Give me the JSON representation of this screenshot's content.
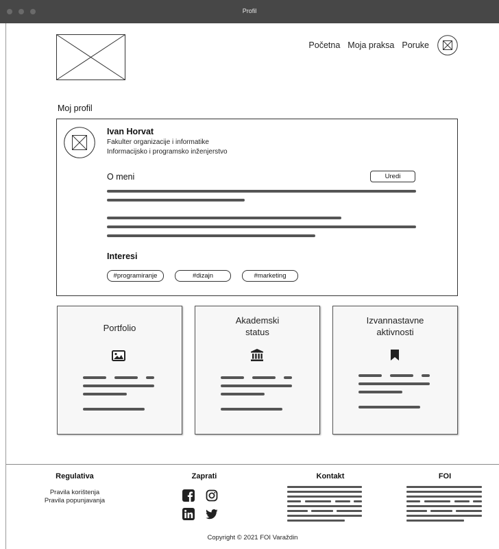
{
  "window": {
    "title": "Profil"
  },
  "header": {
    "nav": [
      {
        "label": "Početna"
      },
      {
        "label": "Moja praksa"
      },
      {
        "label": "Poruke"
      }
    ]
  },
  "profile": {
    "section_title": "Moj profil",
    "name": "Ivan Horvat",
    "faculty": "Fakulter organizacije i informatike",
    "program": "Informacijsko i programsko inženjerstvo",
    "about_title": "O meni",
    "edit_label": "Uredi",
    "interests_title": "Interesi",
    "tags": [
      "#programiranje",
      "#dizajn",
      "#marketing"
    ]
  },
  "cards": [
    {
      "title": "Portfolio",
      "icon": "image-icon"
    },
    {
      "title": "Akademski status",
      "icon": "institution-icon"
    },
    {
      "title": "Izvannastavne aktivnosti",
      "icon": "bookmark-icon"
    }
  ],
  "footer": {
    "regulativa": {
      "title": "Regulativa",
      "links": [
        "Pravila korištenja",
        "Pravila popunjavanja"
      ]
    },
    "zaprati": {
      "title": "Zaprati",
      "icons": [
        "facebook-icon",
        "instagram-icon",
        "linkedin-icon",
        "twitter-icon"
      ]
    },
    "kontakt": {
      "title": "Kontakt"
    },
    "foi": {
      "title": "FOI"
    },
    "copyright": "Copyright © 2021 FOI Varaždin"
  }
}
